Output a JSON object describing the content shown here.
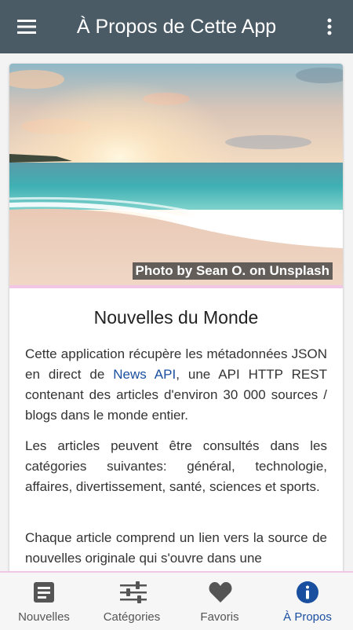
{
  "appbar": {
    "title": "À Propos de Cette App",
    "menu_icon": "hamburger-menu-icon",
    "more_icon": "more-vertical-icon",
    "color": "#4a5b66"
  },
  "card": {
    "photo_credit": "Photo by Sean O. on Unsplash",
    "title": "Nouvelles du Monde",
    "para1_before": "Cette application récupère les métadonnées JSON en direct de ",
    "para1_link": "News API",
    "para1_after": ", une API HTTP REST contenant des articles d'environ 30 000 sources / blogs dans le monde entier.",
    "para2": "Les articles peuvent être consultés dans les catégories suivantes: général, technologie, affaires, divertissement, santé, sciences et sports.",
    "para3": "Chaque article comprend un lien vers la source de nouvelles originale qui s'ouvre dans une"
  },
  "bottom_nav": {
    "items": [
      {
        "label": "Nouvelles",
        "icon": "article-icon"
      },
      {
        "label": "Catégories",
        "icon": "sliders-icon"
      },
      {
        "label": "Favoris",
        "icon": "heart-icon"
      },
      {
        "label": "À Propos",
        "icon": "info-icon"
      }
    ],
    "active_color": "#1a4fa0"
  }
}
